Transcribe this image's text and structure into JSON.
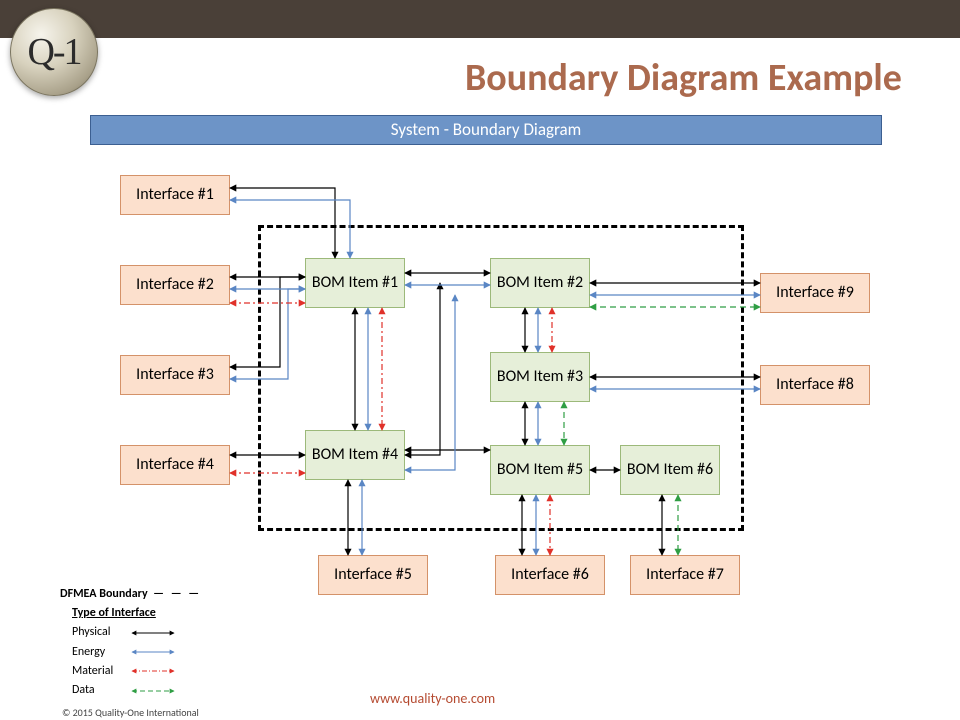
{
  "header": {
    "title": "Boundary Diagram Example",
    "banner": "System - Boundary Diagram",
    "logo_text": "Q-1"
  },
  "interfaces": {
    "i1": "Interface #1",
    "i2": "Interface #2",
    "i3": "Interface #3",
    "i4": "Interface #4",
    "i5": "Interface #5",
    "i6": "Interface #6",
    "i7": "Interface #7",
    "i8": "Interface #8",
    "i9": "Interface #9"
  },
  "bom": {
    "b1": "BOM Item #1",
    "b2": "BOM Item #2",
    "b3": "BOM Item #3",
    "b4": "BOM Item #4",
    "b5": "BOM Item #5",
    "b6": "BOM Item #6"
  },
  "legend": {
    "boundary": "DFMEA Boundary",
    "type_hdr": "Type of Interface",
    "physical": "Physical",
    "energy": "Energy",
    "material": "Material",
    "data": "Data"
  },
  "footer": {
    "url": "www.quality-one.com",
    "copyright": "© 2015 Quality-One International"
  },
  "colors": {
    "physical": "#000000",
    "energy": "#5a86c4",
    "material": "#e0312a",
    "data": "#2f9e44"
  }
}
